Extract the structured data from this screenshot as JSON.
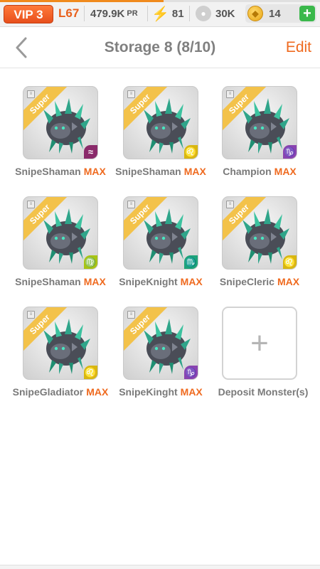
{
  "status": {
    "vip_label": "VIP 3",
    "level": "L67",
    "power_value": "479.9K",
    "power_unit": "PR",
    "energy": "81",
    "food": "30K",
    "coins": "14",
    "add_label": "+"
  },
  "nav": {
    "back_icon": "chevron-left-icon",
    "title": "Storage 8 (8/10)",
    "edit_label": "Edit"
  },
  "monsters": [
    {
      "name": "SnipeShaman",
      "max": "MAX",
      "badge": "Super",
      "sign": "≈",
      "sign_color": "#8a2a6a"
    },
    {
      "name": "SnipeShaman",
      "max": "MAX",
      "badge": "Super",
      "sign": "♌",
      "sign_color": "#d8b711"
    },
    {
      "name": "Champion",
      "max": "MAX",
      "badge": "Super",
      "sign": "♑",
      "sign_color": "#8a44b0"
    },
    {
      "name": "SnipeShaman",
      "max": "MAX",
      "badge": "Super",
      "sign": "♍",
      "sign_color": "#a8c414"
    },
    {
      "name": "SnipeKnight",
      "max": "MAX",
      "badge": "Super",
      "sign": "♏",
      "sign_color": "#1ea37a"
    },
    {
      "name": "SnipeCleric",
      "max": "MAX",
      "badge": "Super",
      "sign": "♌",
      "sign_color": "#d8b711"
    },
    {
      "name": "SnipeGladiator",
      "max": "MAX",
      "badge": "Super",
      "sign": "♌",
      "sign_color": "#d8b711"
    },
    {
      "name": "SnipeKinght",
      "max": "MAX",
      "badge": "Super",
      "sign": "♑",
      "sign_color": "#8a44b0"
    }
  ],
  "deposit": {
    "plus": "+",
    "label": "Deposit Monster(s)"
  }
}
